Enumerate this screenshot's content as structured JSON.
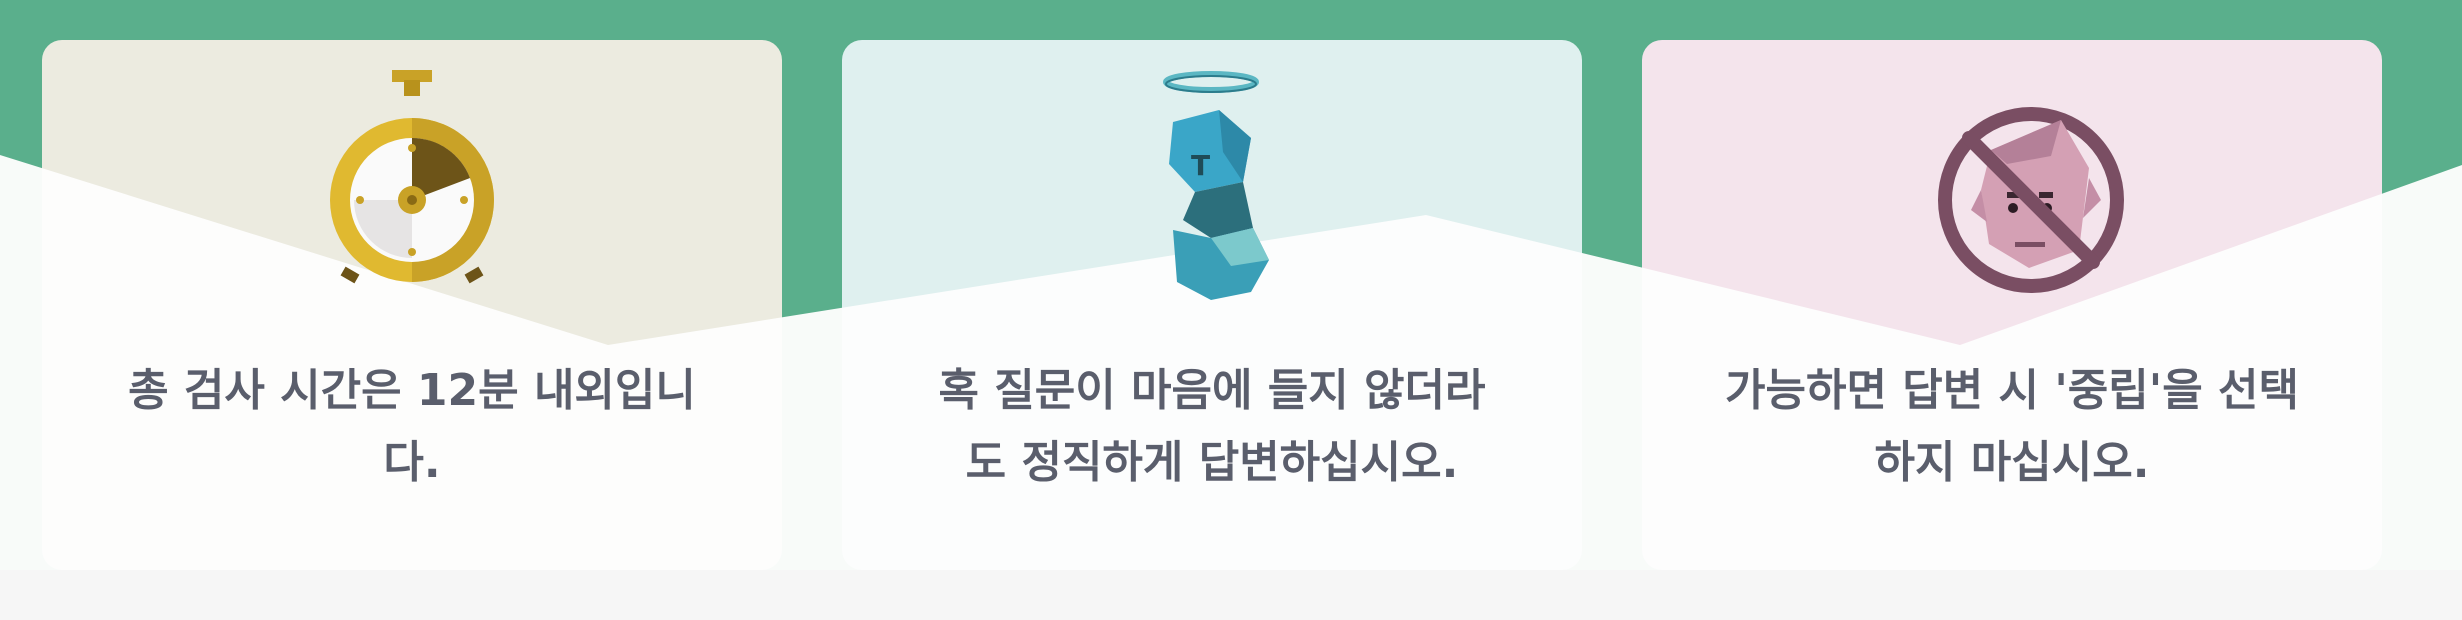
{
  "theme": {
    "accent": "#5aaf8c",
    "text_color": "#5a5e6c"
  },
  "cards": [
    {
      "icon": "stopwatch-icon",
      "text": "총 검사 시간은 12분 내외입니다."
    },
    {
      "icon": "angel-statue-icon",
      "text": "혹 질문이 마음에 들지 않더라도 정직하게 답변하십시오."
    },
    {
      "icon": "no-neutral-face-icon",
      "text": "가능하면 답변 시 '중립'을 선택하지 마십시오."
    }
  ]
}
